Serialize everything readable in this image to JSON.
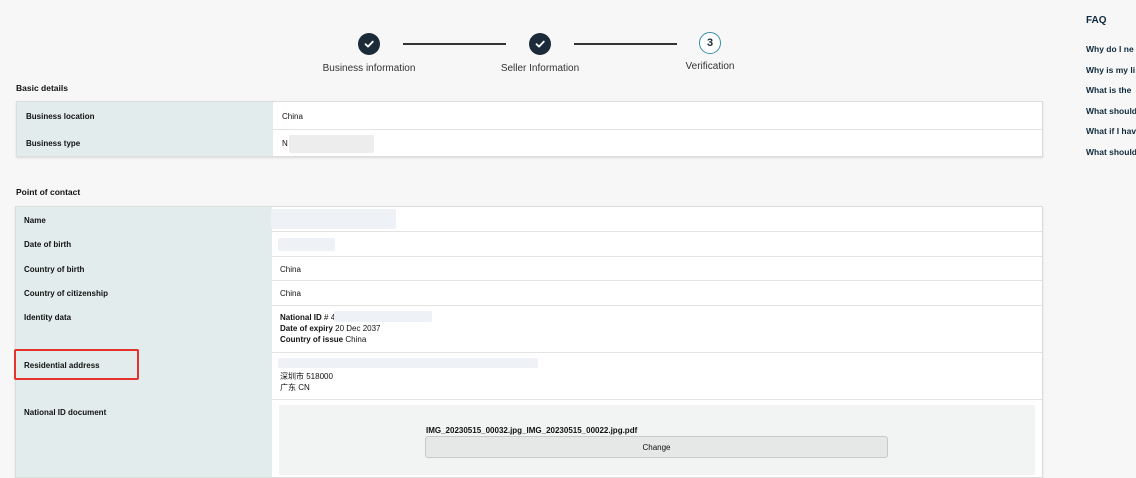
{
  "stepper": {
    "steps": [
      {
        "label": "Business information",
        "state": "complete"
      },
      {
        "label": "Seller Information",
        "state": "complete"
      },
      {
        "label": "Verification",
        "number": "3",
        "state": "current"
      }
    ]
  },
  "basic_details": {
    "title": "Basic details",
    "rows": [
      {
        "label": "Business location",
        "value": "China"
      },
      {
        "label": "Business type",
        "value": "N"
      }
    ]
  },
  "point_of_contact": {
    "title": "Point of contact",
    "name_label": "Name",
    "dob_label": "Date of birth",
    "country_of_birth_label": "Country of birth",
    "country_of_birth_value": "China",
    "citizenship_label": "Country of citizenship",
    "citizenship_value": "China",
    "identity_label": "Identity data",
    "identity": {
      "id_label": "National ID",
      "id_value": "# 4",
      "expiry_label": "Date of expiry",
      "expiry_value": "20 Dec 2037",
      "issue_label": "Country of issue",
      "issue_value": "China"
    },
    "address_label": "Residential address",
    "address_line2": "深圳市 518000",
    "address_line3": "广东 CN",
    "national_id_doc_label": "National ID document",
    "file_name": "IMG_20230515_00032.jpg_IMG_20230515_00022.jpg.pdf",
    "change_label": "Change"
  },
  "faq": {
    "title": "FAQ",
    "items": [
      "Why do I ne",
      "Why is my li",
      "What is the",
      "What should",
      "What if I hav",
      "What should"
    ]
  },
  "colors": {
    "step_complete": "#1c2b39",
    "step_current_border": "#3b8ea5",
    "label_bg": "#e3ecec",
    "highlight": "#e5322d"
  }
}
